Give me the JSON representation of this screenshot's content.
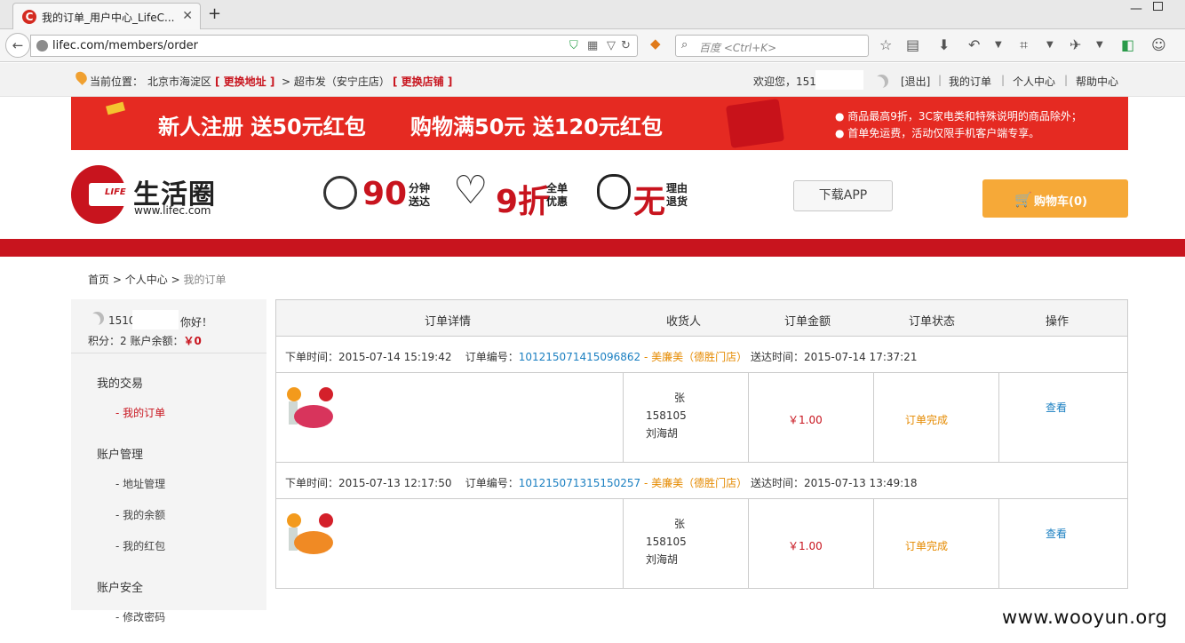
{
  "browser": {
    "tab_title": "我的订单_用户中心_LifeC...",
    "tab_favicon": "C",
    "url": "lifec.com/members/order",
    "search_placeholder": "百度 <Ctrl+K>"
  },
  "topbar": {
    "location_label": "当前位置：",
    "location_value": "北京市海淀区",
    "change_address": "[ 更换地址 ]",
    "store_prefix": ">  超市发（安宁庄店）",
    "change_store": "[ 更换店铺 ]",
    "welcome": "欢迎您，151",
    "logout": "[退出]",
    "my_orders": "我的订单",
    "user_center": "个人中心",
    "help_center": "帮助中心",
    "separator": "|"
  },
  "banner": {
    "promo1": "新人注册 送50元红包",
    "promo2": "购物满50元 送120元红包",
    "note1": "● 商品最高9折，3C家电类和特殊说明的商品除外；",
    "note2": "● 首单免运费，活动仅限手机客户端专享。"
  },
  "header": {
    "logo_life": "LIFE",
    "logo_name": "生活圈",
    "logo_url": "www.lifec.com",
    "features": [
      {
        "big": "90",
        "small1": "分钟",
        "small2": "送达"
      },
      {
        "big": "9折",
        "small1": "全单",
        "small2": "优惠"
      },
      {
        "big": "无",
        "small1": "理由",
        "small2": "退货"
      }
    ],
    "download_app": "下载APP",
    "cart": "购物车(0)"
  },
  "breadcrumb": {
    "home": "首页",
    "center": "个人中心",
    "current": "我的订单",
    "sep": ">"
  },
  "sidebar": {
    "user": "1510",
    "hello": "你好！",
    "points_label": "积分：2 账户余额：",
    "balance": "￥0",
    "sections": [
      {
        "title": "我的交易",
        "links": [
          "- 我的订单"
        ]
      },
      {
        "title": "账户管理",
        "links": [
          "- 地址管理",
          "- 我的余额",
          "- 我的红包"
        ]
      },
      {
        "title": "账户安全",
        "links": [
          "- 修改密码"
        ]
      }
    ]
  },
  "orders": {
    "columns": [
      "订单详情",
      "收货人",
      "订单金额",
      "订单状态",
      "操作"
    ],
    "list": [
      {
        "order_time_label": "下单时间：",
        "order_time": "2015-07-14 15:19:42",
        "order_no_label": "订单编号：",
        "order_no": "101215071415096862",
        "dash": " - ",
        "store": "美廉美（德胜门店）",
        "delivery_label": " 送达时间：",
        "delivery_time": "2015-07-14 17:37:21",
        "receiver_name": "张",
        "receiver_phone": "158105",
        "receiver_addr": "刘海胡",
        "amount": "￥1.00",
        "status": "订单完成",
        "action": "查看",
        "product": "dragon-fruit"
      },
      {
        "order_time_label": "下单时间：",
        "order_time": "2015-07-13 12:17:50",
        "order_no_label": "订单编号：",
        "order_no": "101215071315150257",
        "dash": " - ",
        "store": "美廉美（德胜门店）",
        "delivery_label": " 送达时间：",
        "delivery_time": "2015-07-13 13:49:18",
        "receiver_name": "张",
        "receiver_phone": "158105",
        "receiver_addr": "刘海胡",
        "amount": "￥1.00",
        "status": "订单完成",
        "action": "查看",
        "product": "papaya"
      }
    ]
  },
  "watermark": "www.wooyun.org",
  "colors": {
    "brand_red": "#c8141e",
    "banner_red": "#e52a22",
    "cart_orange": "#f6a938",
    "link_blue": "#1a7fc1",
    "status_orange": "#e58a00"
  }
}
